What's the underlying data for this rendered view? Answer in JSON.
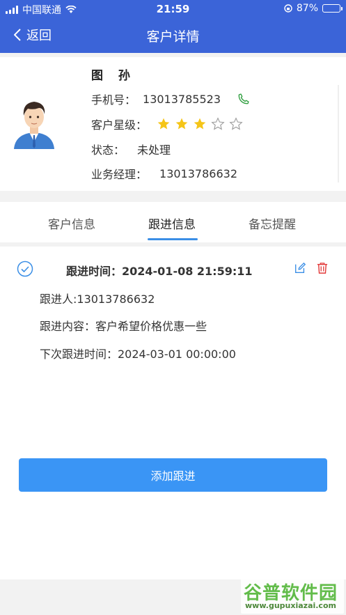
{
  "status_bar": {
    "carrier": "中国联通",
    "time": "21:59",
    "battery": "87%",
    "battery_level": 0.87
  },
  "nav": {
    "back_label": "返回",
    "title": "客户详情"
  },
  "customer": {
    "name": "图 孙",
    "phone_label": "手机号：",
    "phone": "13013785523",
    "level_label": "客户星级：",
    "stars_filled": 3,
    "stars_total": 5,
    "status_label": "状态：",
    "status": "未处理",
    "manager_label": "业务经理：",
    "manager": "13013786632"
  },
  "tabs": [
    {
      "label": "客户信息",
      "active": false
    },
    {
      "label": "跟进信息",
      "active": true
    },
    {
      "label": "备忘提醒",
      "active": false
    }
  ],
  "follow": {
    "time_line": "跟进时间：2024-01-08 21:59:11",
    "person_line": "跟进人:13013786632",
    "content_line": "跟进内容：客户希望价格优惠一些",
    "next_line": "下次跟进时间：2024-03-01 00:00:00"
  },
  "add_button": "添加跟进",
  "watermark": {
    "text": "谷普软件园",
    "url": "www.gupuxiazai.com"
  },
  "colors": {
    "header": "#3b64d8",
    "star_active": "#f5c518",
    "accent": "#3a95f5",
    "phone_icon": "#2e9e3e",
    "delete_icon": "#e23b3b"
  }
}
